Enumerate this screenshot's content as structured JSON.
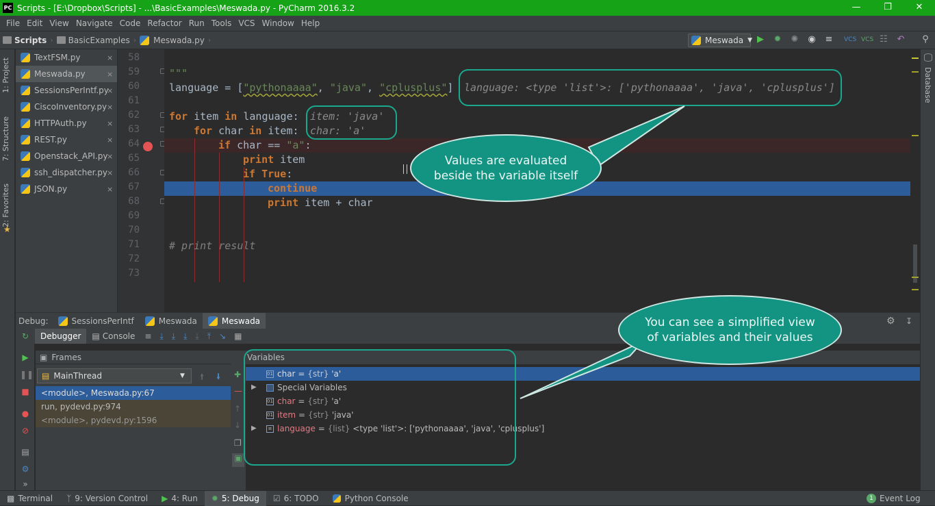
{
  "window": {
    "title": "Scripts - [E:\\Dropbox\\Scripts] - ...\\BasicExamples\\Meswada.py - PyCharm 2016.3.2",
    "app_icon": "PC"
  },
  "menu": [
    "File",
    "Edit",
    "View",
    "Navigate",
    "Code",
    "Refactor",
    "Run",
    "Tools",
    "VCS",
    "Window",
    "Help"
  ],
  "breadcrumb": [
    "Scripts",
    "BasicExamples",
    "Meswada.py"
  ],
  "run_config": "Meswada",
  "left_tabs": [
    "1: Project",
    "7: Structure",
    "2: Favorites"
  ],
  "right_tabs": [
    "Database"
  ],
  "open_files": [
    {
      "name": "TextFSM.py",
      "active": false
    },
    {
      "name": "Meswada.py",
      "active": true
    },
    {
      "name": "SessionsPerIntf.py",
      "active": false
    },
    {
      "name": "CiscoInventory.py",
      "active": false
    },
    {
      "name": "HTTPAuth.py",
      "active": false
    },
    {
      "name": "REST.py",
      "active": false
    },
    {
      "name": "Openstack_API.py",
      "active": false
    },
    {
      "name": "ssh_dispatcher.py",
      "active": false
    },
    {
      "name": "JSON.py",
      "active": false
    }
  ],
  "close_glyph": "×",
  "editor": {
    "line_numbers": [
      "58",
      "59",
      "60",
      "61",
      "62",
      "63",
      "64",
      "65",
      "66",
      "67",
      "68",
      "69",
      "70",
      "71",
      "72",
      "73"
    ],
    "code": {
      "l59": "\"\"\"",
      "l60_a": "language = [",
      "l60_s1": "\"pythonaaaa\"",
      "l60_c1": ", ",
      "l60_s2": "\"java\"",
      "l60_c2": ", ",
      "l60_s3": "\"cplusplus\"",
      "l60_b": "]",
      "l60_inline": "language: <type 'list'>: ['pythonaaaa', 'java', 'cplusplus']",
      "l62_kw1": "for",
      "l62_mid": " item ",
      "l62_kw2": "in",
      "l62_end": " language:",
      "l62_inline": "item: 'java'",
      "l63_kw1": "for",
      "l63_mid": " char ",
      "l63_kw2": "in",
      "l63_end": " item:",
      "l63_inline": "char: 'a'",
      "l64_kw": "if",
      "l64_mid": " char == ",
      "l64_str": "\"a\"",
      "l64_end": ":",
      "l65_kw": "print",
      "l65_end": " item",
      "l66_kw": "if",
      "l66_kw2": "True",
      "l66_end": ":",
      "l67_kw": "continue",
      "l68_kw": "print",
      "l68_end": " item + char",
      "l71": "# print result"
    }
  },
  "debug": {
    "label": "Debug:",
    "tabs": [
      {
        "name": "SessionsPerIntf",
        "active": false
      },
      {
        "name": "Meswada",
        "active": false
      },
      {
        "name": "Meswada",
        "active": true
      }
    ],
    "toolbar_tabs": [
      "Debugger",
      "Console"
    ],
    "frames_title": "Frames",
    "thread": "MainThread",
    "frames": [
      "<module>, Meswada.py:67",
      "run, pydevd.py:974",
      "<module>, pydevd.py:1596"
    ],
    "variables_title": "Variables",
    "variables": [
      {
        "name": "char",
        "type": "{str}",
        "value": "'a'",
        "selected": true,
        "expand": ""
      },
      {
        "name": "Special Variables",
        "type": "",
        "value": "",
        "selected": false,
        "expand": "▶"
      },
      {
        "name": "char",
        "type": "{str}",
        "value": "'a'",
        "selected": false,
        "expand": ""
      },
      {
        "name": "item",
        "type": "{str}",
        "value": "'java'",
        "selected": false,
        "expand": ""
      },
      {
        "name": "language",
        "type": "{list}",
        "value": "<type 'list'>: ['pythonaaaa', 'java', 'cplusplus']",
        "selected": false,
        "expand": "▶"
      }
    ],
    "var_eq": " = "
  },
  "callouts": {
    "top": "Values are evaluated beside the variable itself",
    "bottom": "You can see a simplified view of variables and their values"
  },
  "statusbar": {
    "tabs": [
      {
        "name": "Terminal",
        "active": false
      },
      {
        "name": "9: Version Control",
        "active": false
      },
      {
        "name": "4: Run",
        "active": false
      },
      {
        "name": "5: Debug",
        "active": true
      },
      {
        "name": "6: TODO",
        "active": false
      },
      {
        "name": "Python Console",
        "active": false
      }
    ],
    "event_log": "Event Log",
    "event_count": "1"
  },
  "colors": {
    "titlebar": "#17a317",
    "callout": "#139483",
    "selection": "#2d5c9a"
  }
}
